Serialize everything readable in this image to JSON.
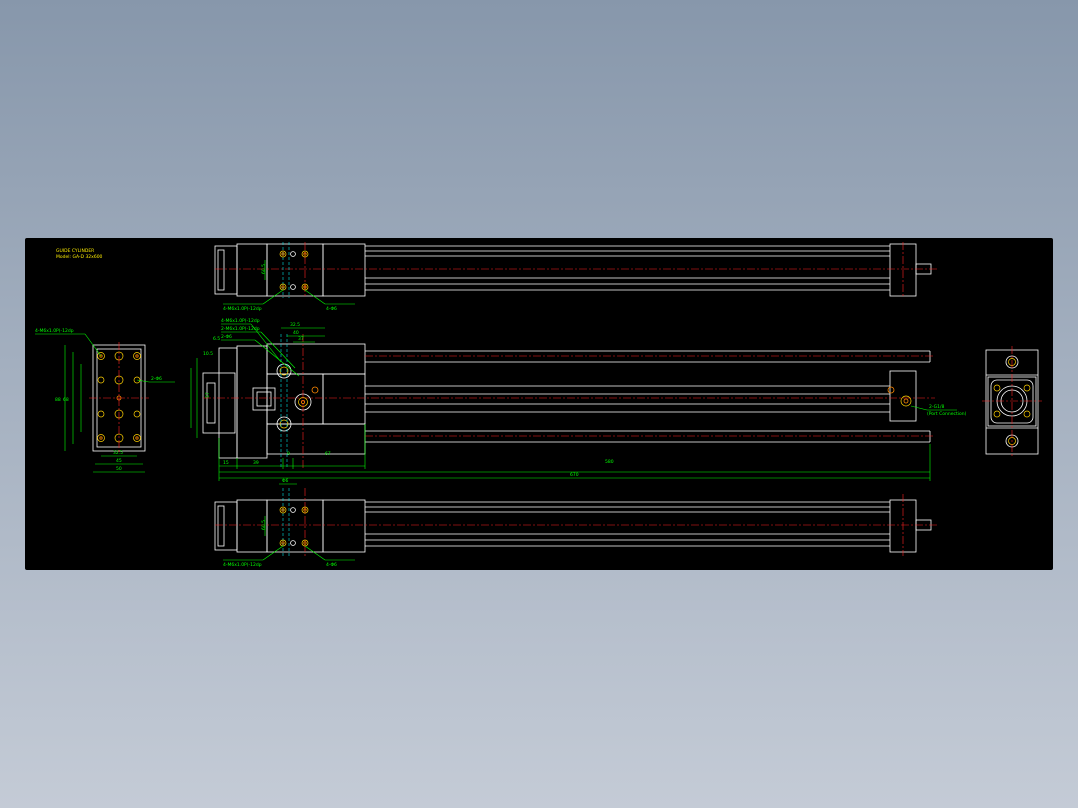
{
  "title_block": {
    "line1": "GUIDE CYLINDER",
    "line2": "Model: GA-D 32x600"
  },
  "top_view": {
    "note_left": "4-M6x1.0P(-12dp",
    "note_right": "4-Φ6",
    "dim_vertical": "60.5"
  },
  "front_view": {
    "note_a": "4-M6x1.0P(-12dp",
    "note_b": "2-M6x1.0P(-12dp",
    "note_c": "2-Φ6",
    "note_port": "2-G1/8",
    "note_port_sub": "(Port Connection)",
    "dims": [
      "32.5",
      "40",
      "37",
      "57",
      "15",
      "39",
      "9",
      "67",
      "580",
      "670",
      "10.5",
      "6.5"
    ]
  },
  "side_view": {
    "note_left": "4-M6x1.0P(-12dp",
    "note_right": "2-Φ6",
    "dims": [
      "88",
      "68",
      "32.5",
      "45",
      "50"
    ]
  },
  "bottom_view": {
    "note_left": "4-M6x1.0P(-12dp",
    "note_right": "4-Φ6",
    "dim_top": "Φ6",
    "dim_vertical": "60.5"
  },
  "colors": {
    "background_sheet": "#000000",
    "outline": "#ffffff",
    "dimension": "#00ff00",
    "centerline": "#ff2222",
    "hidden": "#00e0e0",
    "holes": "#ffd000"
  }
}
